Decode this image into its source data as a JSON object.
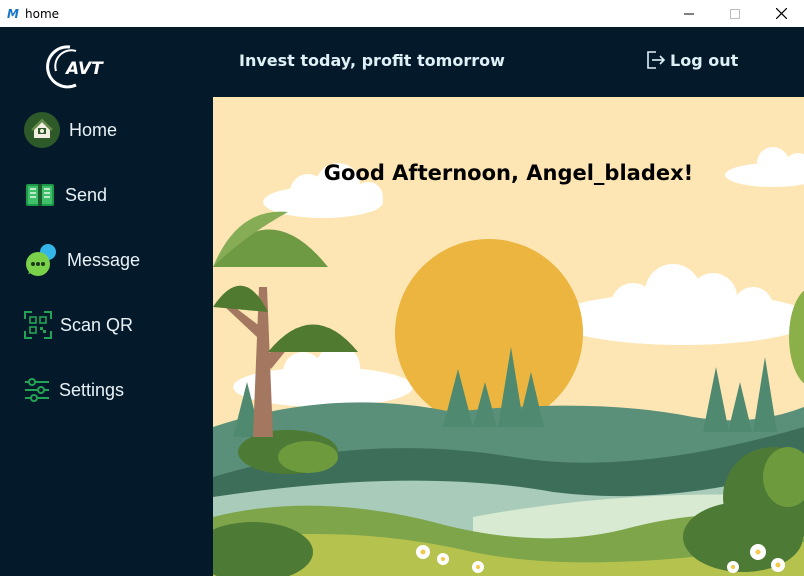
{
  "window": {
    "title": "home",
    "app_icon_text": "M",
    "controls": [
      "minimize",
      "maximize",
      "close"
    ]
  },
  "logo": {
    "text": "AVT"
  },
  "header": {
    "tagline": "Invest today, profit tomorrow",
    "logout_label": "Log out"
  },
  "sidebar": {
    "items": [
      {
        "label": "Home",
        "icon": "home-icon"
      },
      {
        "label": "Send",
        "icon": "send-icon"
      },
      {
        "label": "Message",
        "icon": "message-icon"
      },
      {
        "label": "Scan QR",
        "icon": "qr-scan-icon"
      },
      {
        "label": "Settings",
        "icon": "settings-icon"
      }
    ]
  },
  "main": {
    "greeting": "Good Afternoon, Angel_bladex!"
  },
  "colors": {
    "sidebar_bg": "#041a2b",
    "text_light": "#e9f2f7",
    "sky": "#fde6b3",
    "sun": "#ebb53f",
    "accent_green": "#23a455"
  }
}
